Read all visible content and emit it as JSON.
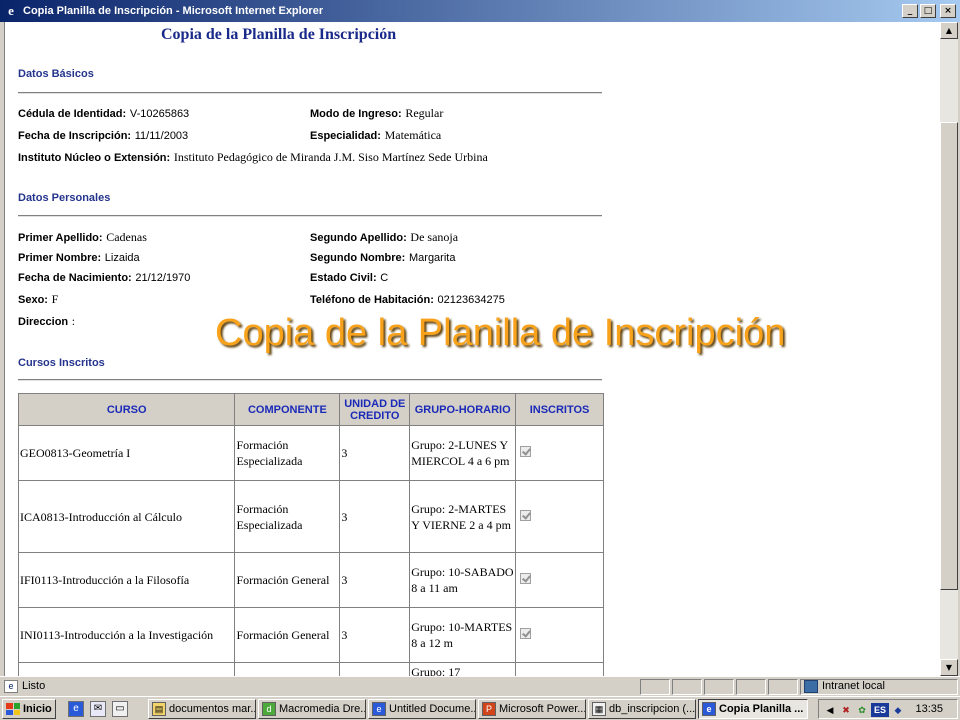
{
  "window": {
    "title": "Copia Planilla de Inscripción - Microsoft Internet Explorer",
    "minimize": "_",
    "maximize": "□",
    "close": "×"
  },
  "page": {
    "title": "Copia de la Planilla de Inscripción",
    "overlay_caption": "Copia de la Planilla de Inscripción"
  },
  "datos_basicos": {
    "heading": "Datos Básicos",
    "cedula_label": "Cédula de Identidad:",
    "cedula_value": "V-10265863",
    "modo_label": "Modo de Ingreso:",
    "modo_value": "Regular",
    "fecha_label": "Fecha de Inscripción:",
    "fecha_value": "11/11/2003",
    "especialidad_label": "Especialidad:",
    "especialidad_value": "Matemática",
    "instituto_label": "Instituto Núcleo o Extensión:",
    "instituto_value": "Instituto Pedagógico de Miranda J.M. Siso Martínez Sede Urbina"
  },
  "datos_personales": {
    "heading": "Datos Personales",
    "primer_apellido_label": "Primer Apellido:",
    "primer_apellido_value": "Cadenas",
    "segundo_apellido_label": "Segundo Apellido:",
    "segundo_apellido_value": "De sanoja",
    "primer_nombre_label": "Primer Nombre:",
    "primer_nombre_value": "Lizaida",
    "segundo_nombre_label": "Segundo Nombre:",
    "segundo_nombre_value": "Margarita",
    "nacimiento_label": "Fecha de Nacimiento:",
    "nacimiento_value": "21/12/1970",
    "estado_civil_label": "Estado Civil:",
    "estado_civil_value": "C",
    "sexo_label": "Sexo:",
    "sexo_value": "F",
    "telefono_label": "Teléfono de Habitación:",
    "telefono_value": "02123634275",
    "direccion_label": "Direccion",
    "direccion_value": ":"
  },
  "cursos": {
    "heading": "Cursos Inscritos",
    "columns": [
      "CURSO",
      "COMPONENTE",
      "UNIDAD DE CREDITO",
      "GRUPO-HORARIO",
      "INSCRITOS"
    ],
    "rows": [
      {
        "curso": "GEO0813-Geometría I",
        "componente": "Formación Especializada",
        "credito": "3",
        "grupo": "Grupo: 2-LUNES Y MIERCOL 4 a 6 pm",
        "inscrito": true
      },
      {
        "curso": "ICA0813-Introducción al Cálculo",
        "componente": "Formación Especializada",
        "credito": "3",
        "grupo": "Grupo: 2-MARTES Y VIERNE 2 a 4 pm",
        "inscrito": true
      },
      {
        "curso": "IFI0113-Introducción a la Filosofía",
        "componente": "Formación General",
        "credito": "3",
        "grupo": "Grupo: 10-SABADO 8 a 11 am",
        "inscrito": true
      },
      {
        "curso": "INI0113-Introducción a la Investigación",
        "componente": "Formación General",
        "credito": "3",
        "grupo": "Grupo: 10-MARTES 8 a 12 m",
        "inscrito": true
      },
      {
        "curso": "",
        "componente": "",
        "credito": "",
        "grupo": "Grupo: 17",
        "inscrito": false
      }
    ]
  },
  "statusbar": {
    "status": "Listo",
    "zone": "Intranet local"
  },
  "taskbar": {
    "start": "Inicio",
    "tasks": [
      "documentos mar...",
      "Macromedia Dre...",
      "Untitled Docume...",
      "Microsoft Power...",
      "db_inscripcion (...",
      "Copia Planilla ..."
    ],
    "language": "ES",
    "clock": "13:35"
  }
}
